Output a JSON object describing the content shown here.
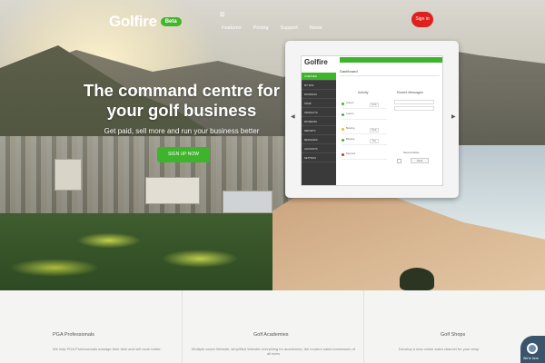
{
  "brand": {
    "logo_text": "Golfire",
    "badge": "Beta",
    "accent_green": "#3db42b",
    "signin_red": "#e0201f"
  },
  "nav": {
    "menu_icon": "hamburger-icon",
    "links": [
      "Features",
      "Pricing",
      "Support",
      "News"
    ],
    "signin_label": "Sign in"
  },
  "hero": {
    "headline_line1": "The command centre for",
    "headline_line2": "your golf business",
    "subheadline": "Get paid, sell more and run your business better",
    "cta_label": "SIGN UP NOW"
  },
  "device_app": {
    "logo": "Golfire",
    "title": "Dashboard",
    "sidebar_items": [
      "OVERVIEW",
      "MY SITE",
      "BOOKINGS",
      "STAFF",
      "PRODUCTS",
      "PAYMENTS",
      "REPORTS",
      "MESSAGES",
      "ACCOUNTS",
      "SETTINGS"
    ],
    "panel_left_title": "Activity",
    "panel_right_title": "Recent Messages",
    "rows": [
      "Lesson",
      "Lesson",
      "Booking",
      "Booking",
      "Payment"
    ],
    "mini_labels": [
      "Book",
      "Book",
      "Pay"
    ],
    "caption": "Send a Notice",
    "button_label": "Send"
  },
  "features": [
    {
      "title": "PGA Professionals",
      "desc": "We help PGA Professionals manage their time and sell more better."
    },
    {
      "title": "Golf Academies",
      "desc": "Multiple coach Website, simplified Website everything for academies, the modern sales businesses of all sizes"
    },
    {
      "title": "Golf Shops",
      "desc": "Develop a new online sales channel for your shop"
    }
  ],
  "chat": {
    "icon": "chat-bubble-icon",
    "label": "We're here"
  }
}
